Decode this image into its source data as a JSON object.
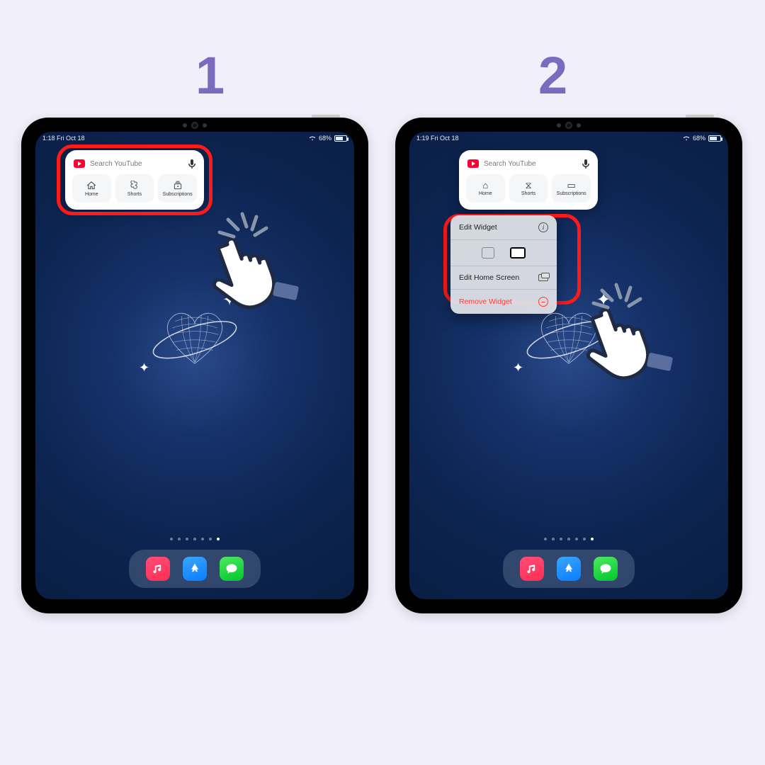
{
  "steps": {
    "one": "1",
    "two": "2"
  },
  "status": {
    "left1": "1:18   Fri Oct 18",
    "left2": "1:19   Fri Oct 18",
    "battery": "68%"
  },
  "widget": {
    "search_placeholder": "Search YouTube",
    "tiles": [
      {
        "label": "Home"
      },
      {
        "label": "Shorts"
      },
      {
        "label": "Subscriptions"
      }
    ]
  },
  "menu": {
    "edit_widget": "Edit Widget",
    "edit_home": "Edit Home Screen",
    "remove": "Remove Widget"
  },
  "dock": {
    "apps": [
      "Apple Music",
      "App Store",
      "Messages"
    ]
  }
}
